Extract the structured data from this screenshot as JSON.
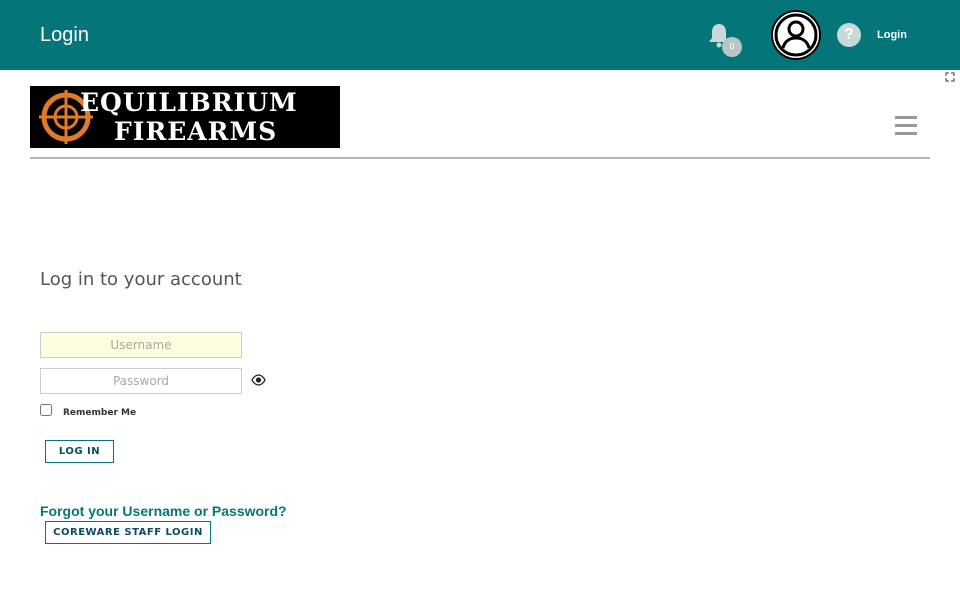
{
  "header": {
    "title": "Login",
    "notification_count": "0",
    "help_glyph": "?",
    "login_link": "Login",
    "icons": [
      "bell-icon",
      "user-avatar-icon",
      "help-icon",
      "expand-icon"
    ]
  },
  "brand": {
    "line1": "EQUILIBRIUM",
    "line2": "FIREARMS",
    "accent_color": "#e07b28"
  },
  "login_form": {
    "heading": "Log in to your account",
    "username": {
      "value": "",
      "placeholder": "Username"
    },
    "password": {
      "value": "",
      "placeholder": "Password"
    },
    "remember_me": {
      "label": "Remember Me",
      "checked": false
    },
    "login_button": "LOG IN",
    "forgot_link": "Forgot your Username or Password?",
    "staff_button": "COREWARE STAFF LOGIN"
  },
  "colors": {
    "header_bg": "#04767a",
    "link": "#04767a",
    "button_text": "#0a4a6a"
  }
}
